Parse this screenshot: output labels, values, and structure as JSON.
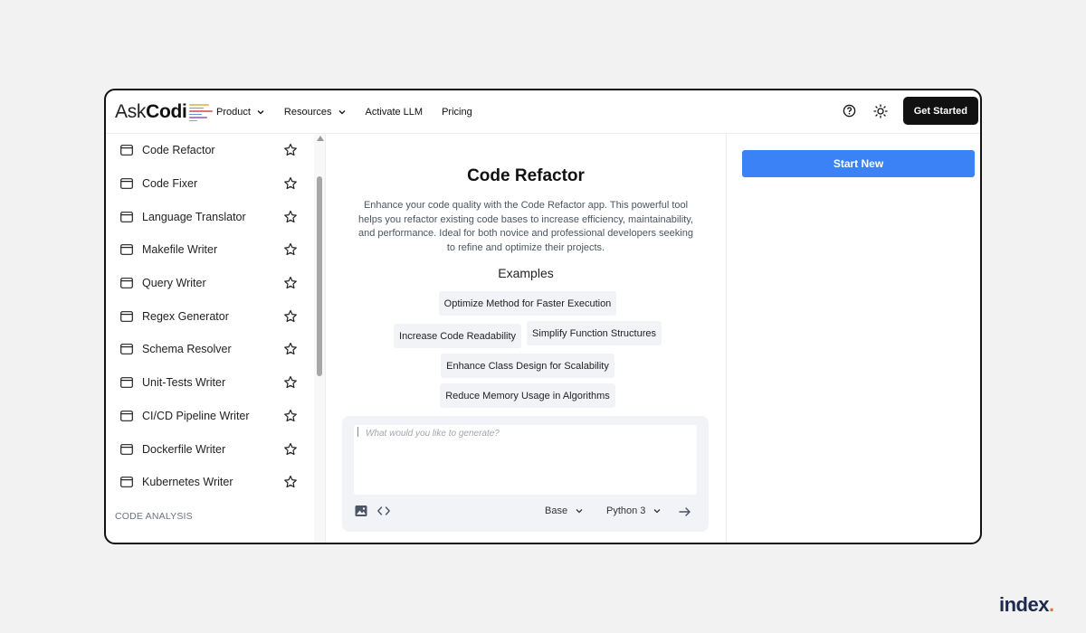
{
  "header": {
    "logo_ask": "Ask",
    "logo_codi": "Codi",
    "nav": [
      {
        "label": "Product",
        "has_dropdown": true
      },
      {
        "label": "Resources",
        "has_dropdown": true
      },
      {
        "label": "Activate LLM",
        "has_dropdown": false
      },
      {
        "label": "Pricing",
        "has_dropdown": false
      }
    ],
    "help_icon": "help-circle-icon",
    "theme_icon": "sun-icon",
    "get_started_label": "Get Started"
  },
  "sidebar": {
    "items": [
      {
        "label": "Code Refactor"
      },
      {
        "label": "Code Fixer"
      },
      {
        "label": "Language Translator"
      },
      {
        "label": "Makefile Writer"
      },
      {
        "label": "Query Writer"
      },
      {
        "label": "Regex Generator"
      },
      {
        "label": "Schema Resolver"
      },
      {
        "label": "Unit-Tests Writer"
      },
      {
        "label": "CI/CD Pipeline Writer"
      },
      {
        "label": "Dockerfile Writer"
      },
      {
        "label": "Kubernetes Writer"
      }
    ],
    "section_label": "CODE ANALYSIS"
  },
  "main": {
    "title": "Code Refactor",
    "description": "Enhance your code quality with the Code Refactor app. This powerful tool helps you refactor existing code bases to increase efficiency, maintainability, and performance. Ideal for both novice and professional developers seeking to refine and optimize their projects.",
    "examples_title": "Examples",
    "examples": [
      "Optimize Method for Faster Execution",
      "Increase Code Readability",
      "Simplify Function Structures",
      "Enhance Class Design for Scalability",
      "Reduce Memory Usage in Algorithms"
    ],
    "composer": {
      "placeholder": "What would you like to generate?",
      "model_select": "Base",
      "language_select": "Python 3"
    }
  },
  "right_panel": {
    "start_new_label": "Start New"
  },
  "colors": {
    "accent_blue": "#3b82f6",
    "dark_button": "#111111"
  },
  "watermark": {
    "text": "index",
    "dot": "."
  }
}
